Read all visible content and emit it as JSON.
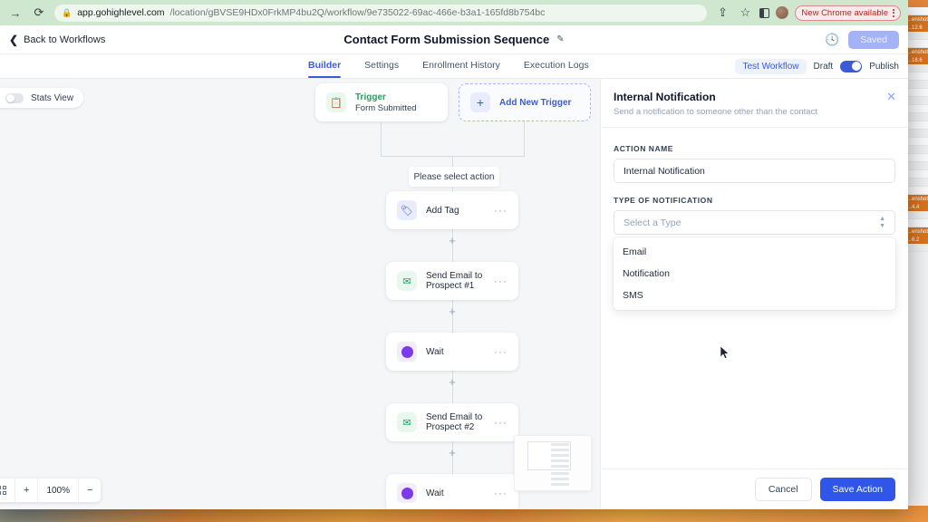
{
  "browser": {
    "url_main": "app.gohighlevel.com",
    "url_rest": "/location/gBVSE9HDx0FrkMP4bu2Q/workflow/9e735022-69ac-466e-b3a1-165fd8b754bc",
    "forward_icon": "→",
    "reload_icon": "⟳",
    "lock_icon": "🔒",
    "share_icon": "⇪",
    "bookmark_icon": "☆",
    "new_chrome_label": "New Chrome available"
  },
  "header": {
    "back_label": "Back to Workflows",
    "title": "Contact Form Submission Sequence",
    "edit_icon": "✎",
    "history_icon": "🕘",
    "saved_label": "Saved"
  },
  "tabs": {
    "items": [
      {
        "label": "Builder",
        "active": true
      },
      {
        "label": "Settings",
        "active": false
      },
      {
        "label": "Enrollment History",
        "active": false
      },
      {
        "label": "Execution Logs",
        "active": false
      }
    ],
    "test_workflow_label": "Test Workflow",
    "draft_label": "Draft",
    "publish_label": "Publish",
    "publish_toggle_on": true
  },
  "canvas": {
    "stats_view_label": "Stats View",
    "stats_view_on": false,
    "trigger": {
      "title": "Trigger",
      "subtitle": "Form Submitted",
      "icon": "clipboard-icon"
    },
    "add_trigger_label": "Add New Trigger",
    "select_action_label": "Please select action",
    "nodes": [
      {
        "label": "Add Tag",
        "icon": "tag-icon",
        "menu": "···"
      },
      {
        "label": "Send Email to Prospect #1",
        "icon": "envelope-icon",
        "menu": "···"
      },
      {
        "label": "Wait",
        "icon": "clock-icon",
        "menu": "···"
      },
      {
        "label": "Send Email to Prospect #2",
        "icon": "envelope-icon",
        "menu": "···"
      },
      {
        "label": "Wait",
        "icon": "clock-icon",
        "menu": "···"
      }
    ],
    "zoom": {
      "fit_icon": "fit-screen-icon",
      "zoom_in": "+",
      "level": "100%",
      "zoom_out": "−"
    }
  },
  "panel": {
    "title": "Internal Notification",
    "subtitle": "Send a notification to someone other than the contact",
    "close_icon": "✕",
    "action_name_label": "ACTION NAME",
    "action_name_value": "Internal Notification",
    "type_label": "TYPE OF NOTIFICATION",
    "type_placeholder": "Select a Type",
    "type_value": "",
    "type_options": [
      {
        "label": "Email"
      },
      {
        "label": "Notification"
      },
      {
        "label": "SMS"
      }
    ],
    "cancel_label": "Cancel",
    "save_label": "Save Action"
  },
  "background_window": {
    "items": [
      {
        "name": "…enshot",
        "size": "…12.6"
      },
      {
        "name": "…enshot",
        "size": "…18.6"
      },
      {
        "name": "…enshot",
        "size": "…4.4"
      },
      {
        "name": "…enshot",
        "size": "…6.2"
      }
    ]
  },
  "colors": {
    "accent": "#3b5bdb",
    "save_button": "#2f56e8",
    "saved_chip": "#a4b3f5",
    "toolbar_bg": "#cfe6cf",
    "canvas_bg": "#f5f6f8"
  }
}
